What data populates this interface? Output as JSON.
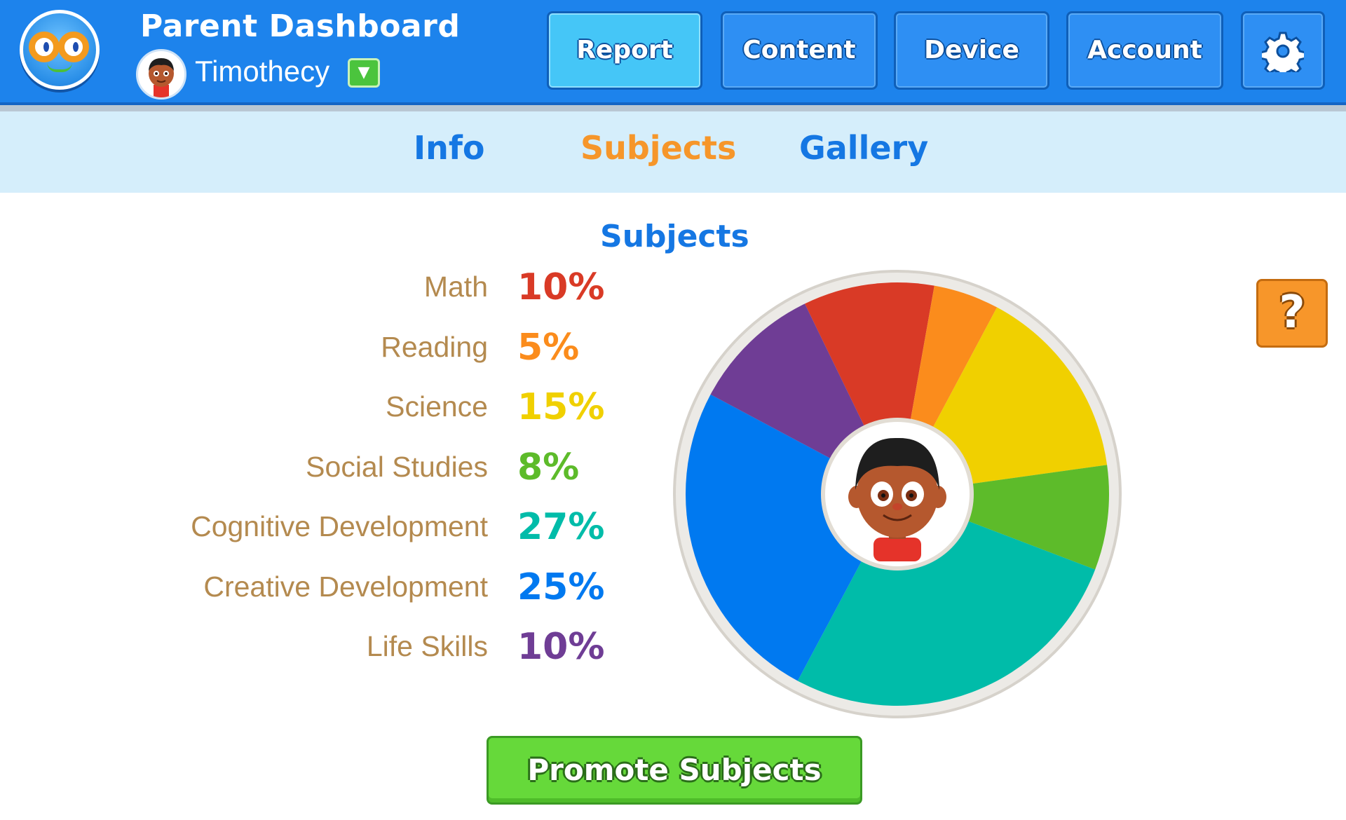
{
  "header": {
    "app_title": "Parent Dashboard",
    "child_name": "Timothecy",
    "nav": [
      {
        "label": "Report",
        "active": true
      },
      {
        "label": "Content",
        "active": false
      },
      {
        "label": "Device",
        "active": false
      },
      {
        "label": "Account",
        "active": false
      }
    ],
    "icons": {
      "logo": "app-logo-icon",
      "dropdown": "chevron-down-icon",
      "settings": "gear-icon"
    }
  },
  "subnav": {
    "tabs": [
      {
        "label": "Info",
        "active": false
      },
      {
        "label": "Subjects",
        "active": true
      },
      {
        "label": "Gallery",
        "active": false
      }
    ]
  },
  "main": {
    "section_title": "Subjects",
    "help_label": "?",
    "promote_label": "Promote Subjects"
  },
  "chart_data": {
    "type": "pie",
    "categories": [
      "Math",
      "Reading",
      "Science",
      "Social Studies",
      "Cognitive Development",
      "Creative Development",
      "Life Skills"
    ],
    "values": [
      10,
      5,
      15,
      8,
      27,
      25,
      10
    ],
    "value_labels": [
      "10%",
      "5%",
      "15%",
      "8%",
      "27%",
      "25%",
      "10%"
    ],
    "colors": [
      "#d93a26",
      "#fb8c1c",
      "#f0d000",
      "#5dbb2a",
      "#00bca9",
      "#0079f0",
      "#6f3d95"
    ],
    "legend_placement": "left",
    "center_image": "child-avatar"
  }
}
